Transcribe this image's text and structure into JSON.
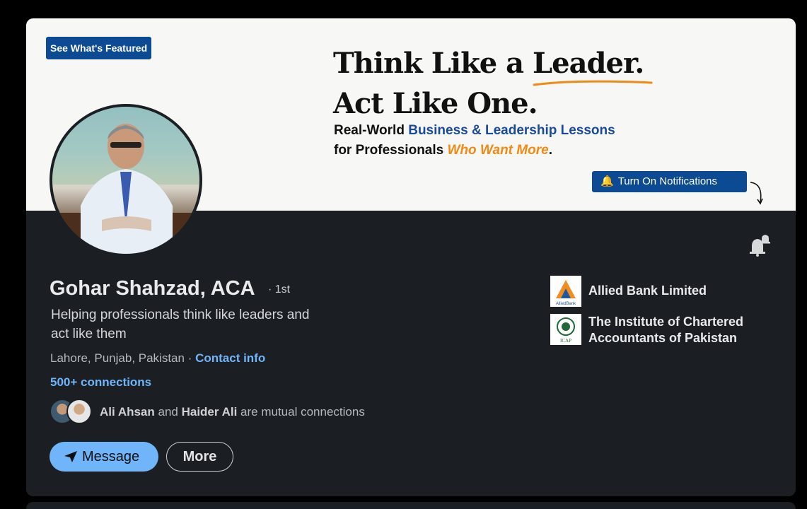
{
  "banner": {
    "featured_label": "See What's Featured",
    "headline_line1_pre": "Think Like a ",
    "headline_line1_emph": "Leader.",
    "headline_line2": "Act Like One.",
    "sub_line1_pre": "Real-World ",
    "sub_line1_emph": "Business & Leadership Lessons",
    "sub_line2_pre": "for Professionals ",
    "sub_line2_emph": "Who Want More",
    "sub_line2_post": ".",
    "notif_label": "Turn On Notifications",
    "colors": {
      "navy": "#0d4a94",
      "orange": "#f08a12",
      "blue_text": "#1a4b9a"
    }
  },
  "profile": {
    "name": "Gohar Shahzad, ACA",
    "degree": "· 1st",
    "tagline": "Helping professionals think like leaders and act like them",
    "location": "Lahore, Punjab, Pakistan",
    "location_sep": " · ",
    "contact_label": "Contact info",
    "connections": "500+ connections",
    "mutual_name1": "Ali Ahsan",
    "mutual_and": " and ",
    "mutual_name2": "Haider Ali",
    "mutual_suffix": " are mutual connections"
  },
  "actions": {
    "message_label": "Message",
    "more_label": "More"
  },
  "companies": [
    {
      "name": "Allied Bank Limited",
      "logo_text": "AlliedBank",
      "icon": "allied-bank-logo"
    },
    {
      "name": "The Institute of Chartered Accountants of Pakistan",
      "logo_text": "ICAP",
      "icon": "icap-logo"
    }
  ],
  "colors": {
    "card_bg": "#1b1f23",
    "link": "#70b5f9",
    "page_bg": "#000000"
  }
}
